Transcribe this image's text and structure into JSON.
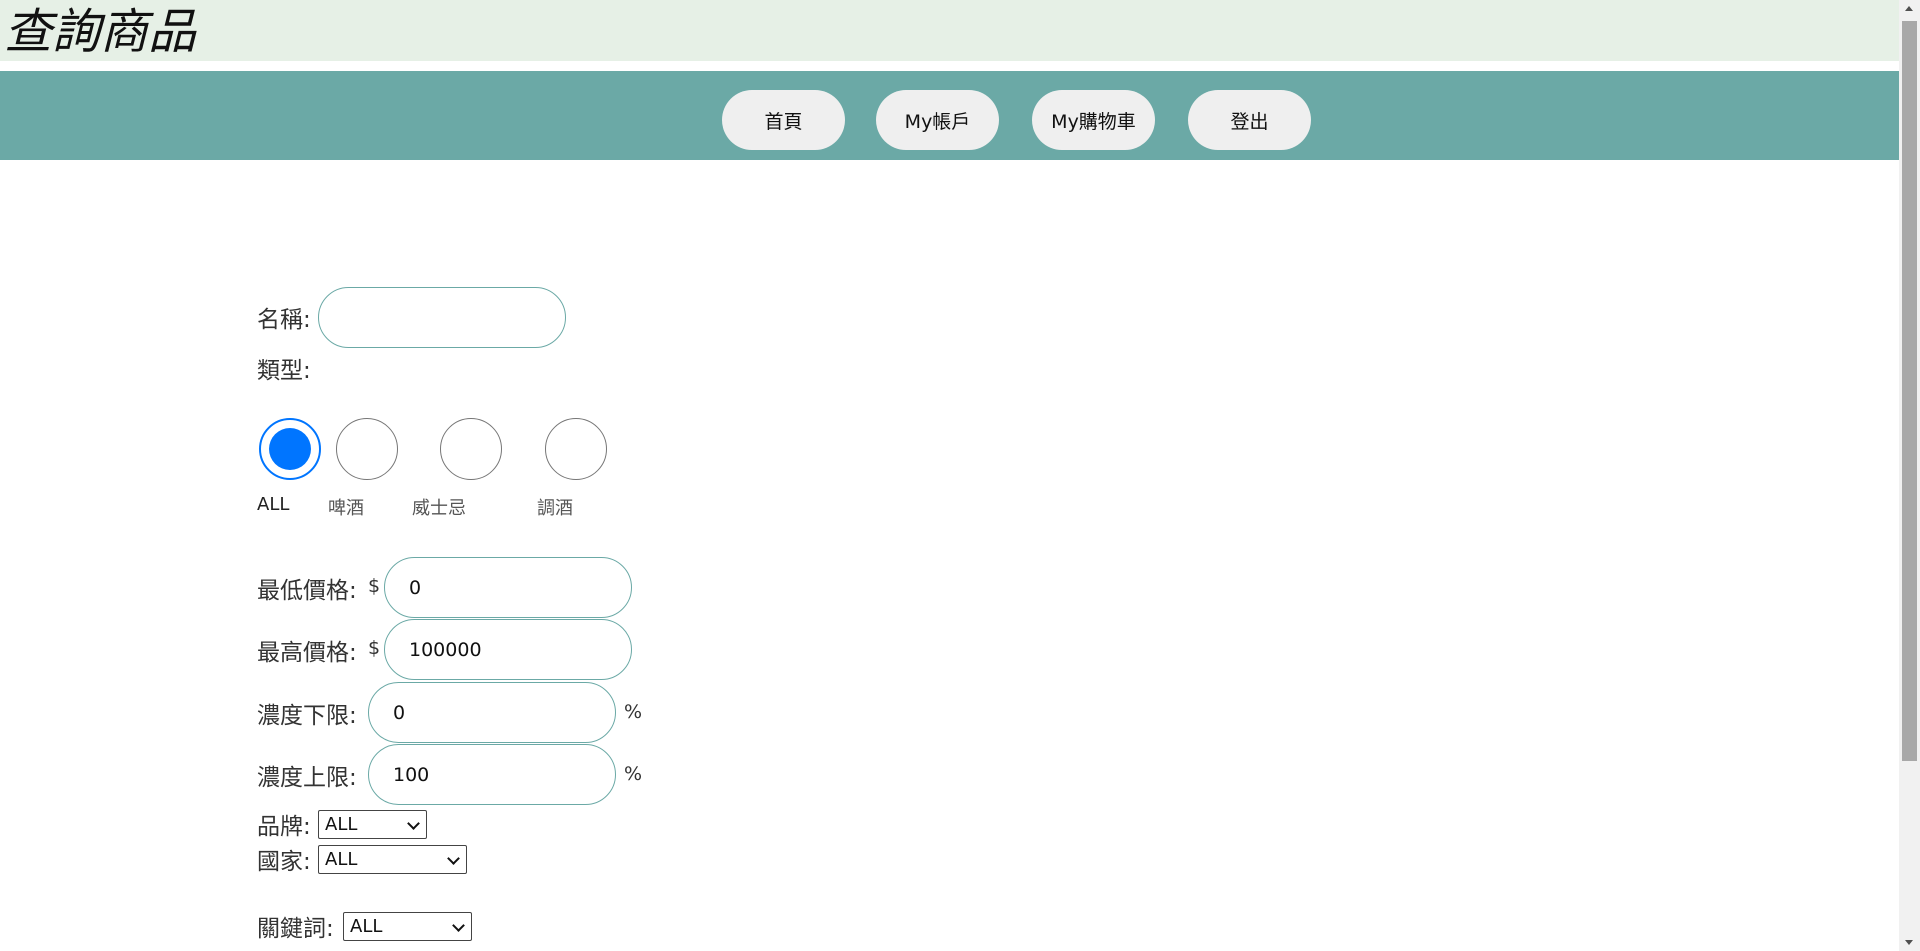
{
  "header": {
    "title": "查詢商品"
  },
  "nav": {
    "items": [
      {
        "label": "首頁"
      },
      {
        "label": "My帳戶"
      },
      {
        "label": "My購物車"
      },
      {
        "label": "登出"
      }
    ]
  },
  "form": {
    "name": {
      "label": "名稱:",
      "value": ""
    },
    "type": {
      "label": "類型:",
      "options": [
        "ALL",
        "啤酒",
        "威士忌",
        "調酒"
      ],
      "selected": "ALL"
    },
    "min_price": {
      "label": "最低價格:",
      "prefix": "$",
      "value": "0"
    },
    "max_price": {
      "label": "最高價格:",
      "prefix": "$",
      "value": "100000"
    },
    "min_abv": {
      "label": "濃度下限:",
      "value": "0",
      "suffix": "%"
    },
    "max_abv": {
      "label": "濃度上限:",
      "value": "100",
      "suffix": "%"
    },
    "brand": {
      "label": "品牌:",
      "selected": "ALL"
    },
    "country": {
      "label": "國家:",
      "selected": "ALL"
    },
    "keyword": {
      "label": "關鍵詞:",
      "selected": "ALL"
    }
  }
}
